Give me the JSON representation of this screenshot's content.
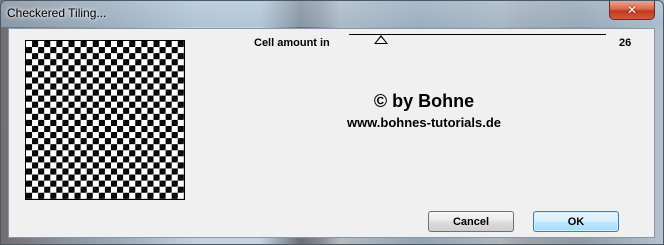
{
  "window": {
    "title": "Checkered Tiling...",
    "close_glyph": "✕"
  },
  "control": {
    "label": "Cell amount in",
    "value": "26",
    "min": 1,
    "max": 200
  },
  "preview": {
    "cells": 26,
    "colors": [
      "#000000",
      "#ffffff"
    ]
  },
  "credit": {
    "copyright": "© by Bohne",
    "website": "www.bohnes-tutorials.de"
  },
  "buttons": {
    "cancel_label": "Cancel",
    "ok_label": "OK"
  },
  "icons": {
    "close": "close-icon",
    "slider_thumb": "triangle-up-icon"
  }
}
